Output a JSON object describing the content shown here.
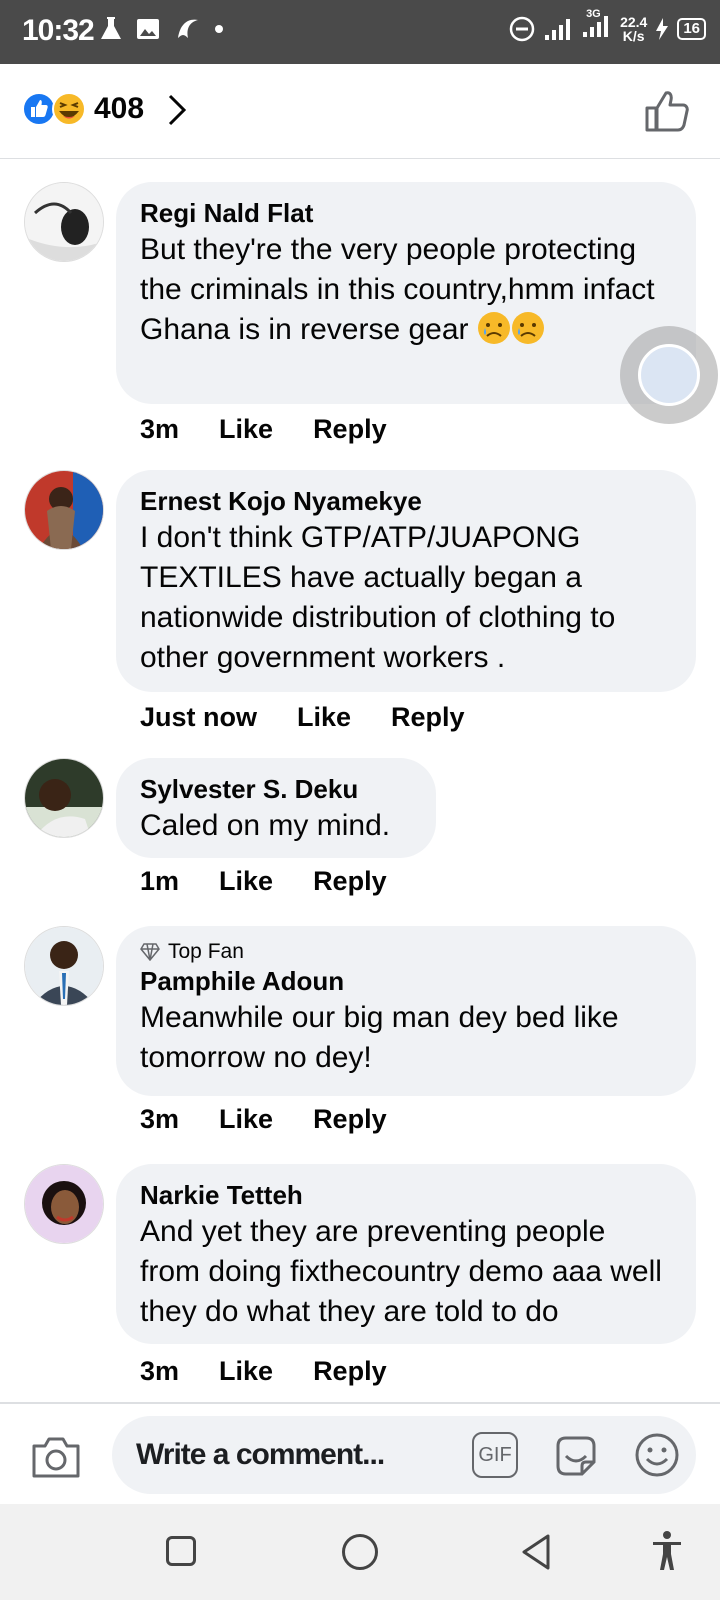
{
  "status_bar": {
    "time": "10:32",
    "net_speed_value": "22.4",
    "net_speed_unit": "K/s",
    "network_type": "3G",
    "battery": "16",
    "icons": [
      "flask-icon",
      "image-icon",
      "app-icon",
      "dot-icon",
      "dnd-icon",
      "signal-icon",
      "signal-icon",
      "charging-icon"
    ]
  },
  "reactions": {
    "count": "408",
    "types": [
      "like",
      "haha"
    ]
  },
  "comments": [
    {
      "author": "Regi Nald Flat",
      "text": "But they're the very people protecting the criminals in this country,hmm infact Ghana is in reverse gear",
      "emojis": [
        "sad-tear",
        "sad-tear"
      ],
      "time": "3m",
      "like_label": "Like",
      "reply_label": "Reply"
    },
    {
      "author": "Ernest Kojo Nyamekye",
      "text": "I don't think GTP/ATP/JUAPONG TEXTILES have actually began a nationwide distribution of clothing to other government workers .",
      "time": "Just now",
      "like_label": "Like",
      "reply_label": "Reply"
    },
    {
      "author": "Sylvester S. Deku",
      "text": "Caled on my mind.",
      "time": "1m",
      "like_label": "Like",
      "reply_label": "Reply"
    },
    {
      "badge": "Top Fan",
      "author": "Pamphile Adoun",
      "text": "Meanwhile our big man dey bed like tomorrow no dey!",
      "time": "3m",
      "like_label": "Like",
      "reply_label": "Reply"
    },
    {
      "author": "Narkie Tetteh",
      "text": "And yet they are preventing people from doing fixthecountry demo aaa well they do what they are told to do",
      "time": "3m",
      "like_label": "Like",
      "reply_label": "Reply"
    }
  ],
  "composer": {
    "placeholder": "Write a comment...",
    "gif_label": "GIF"
  },
  "colors": {
    "like_blue": "#1877f2",
    "haha_yellow": "#f7b928",
    "bubble_bg": "#f0f2f5",
    "status_bar_bg": "#4a4a4a"
  }
}
